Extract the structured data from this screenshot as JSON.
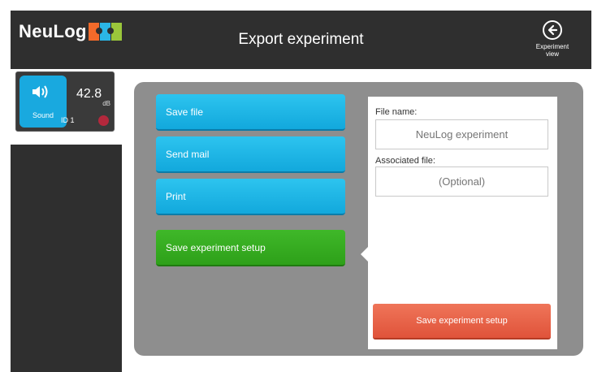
{
  "app": {
    "logo_text": "NeuLog"
  },
  "header": {
    "title": "Export experiment",
    "experiment_view_label_line1": "Experiment",
    "experiment_view_label_line2": "view",
    "experiment_view_icon": "arrow-left-circle-icon"
  },
  "sensor": {
    "name": "Sound",
    "value": "42.8",
    "unit": "dB",
    "id_label": "ID 1",
    "icon": "speaker-icon",
    "color": "#19a9df"
  },
  "actions": [
    {
      "label": "Save file",
      "color": "#1ab3e4"
    },
    {
      "label": "Send mail",
      "color": "#1ab3e4"
    },
    {
      "label": "Print",
      "color": "#1ab3e4"
    },
    {
      "label": "Save experiment setup",
      "color": "#35ad20",
      "selected": true
    }
  ],
  "form": {
    "file_name_label": "File name:",
    "file_name_placeholder": "NeuLog experiment",
    "associated_file_label": "Associated file:",
    "associated_file_placeholder": "(Optional)",
    "submit_label": "Save experiment setup",
    "submit_color": "#e55e43"
  }
}
